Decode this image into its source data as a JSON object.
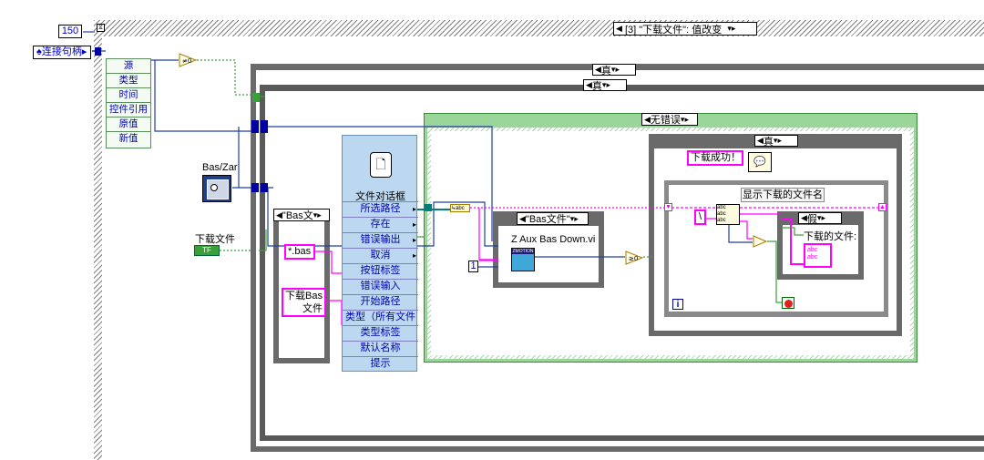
{
  "top_case": {
    "value": "150",
    "selector": "[3] \"下载文件\": 值改变"
  },
  "event_source_label": "连接句柄",
  "event_props": [
    "源",
    "类型",
    "时间",
    "控件引用",
    "原值",
    "新值"
  ],
  "compare_label": "≠0",
  "case_true_1": "真",
  "case_true_2": "真",
  "file_dialog": {
    "title": "文件对话框",
    "outputs": [
      "所选路径",
      "存在",
      "错误输出",
      "取消"
    ],
    "inputs": [
      "按钮标签",
      "错误输入",
      "开始路径",
      "类型（所有文件",
      "类型标签",
      "默认名称",
      "提示"
    ]
  },
  "bas_control": "Bas/Zar",
  "download_file_label": "下载文件",
  "bool_terminal": "TF",
  "bas_case_selector": "\"Bas文",
  "bas_ext": "*.bas",
  "button_label_line1": "下载Bas",
  "button_label_line2": "文件",
  "error_case": "无错误",
  "bas_file_case": "\"Bas文件\"",
  "subvi_name": "Z Aux Bas Down.vi",
  "const_one": "1",
  "compare2": "≥0",
  "case_true_3": "真",
  "download_success": "下载成功！",
  "show_files_label": "显示下载的文件名",
  "false_case": "假",
  "downloaded_files": "下载的文件:",
  "slash": "\\",
  "iteration": "i"
}
